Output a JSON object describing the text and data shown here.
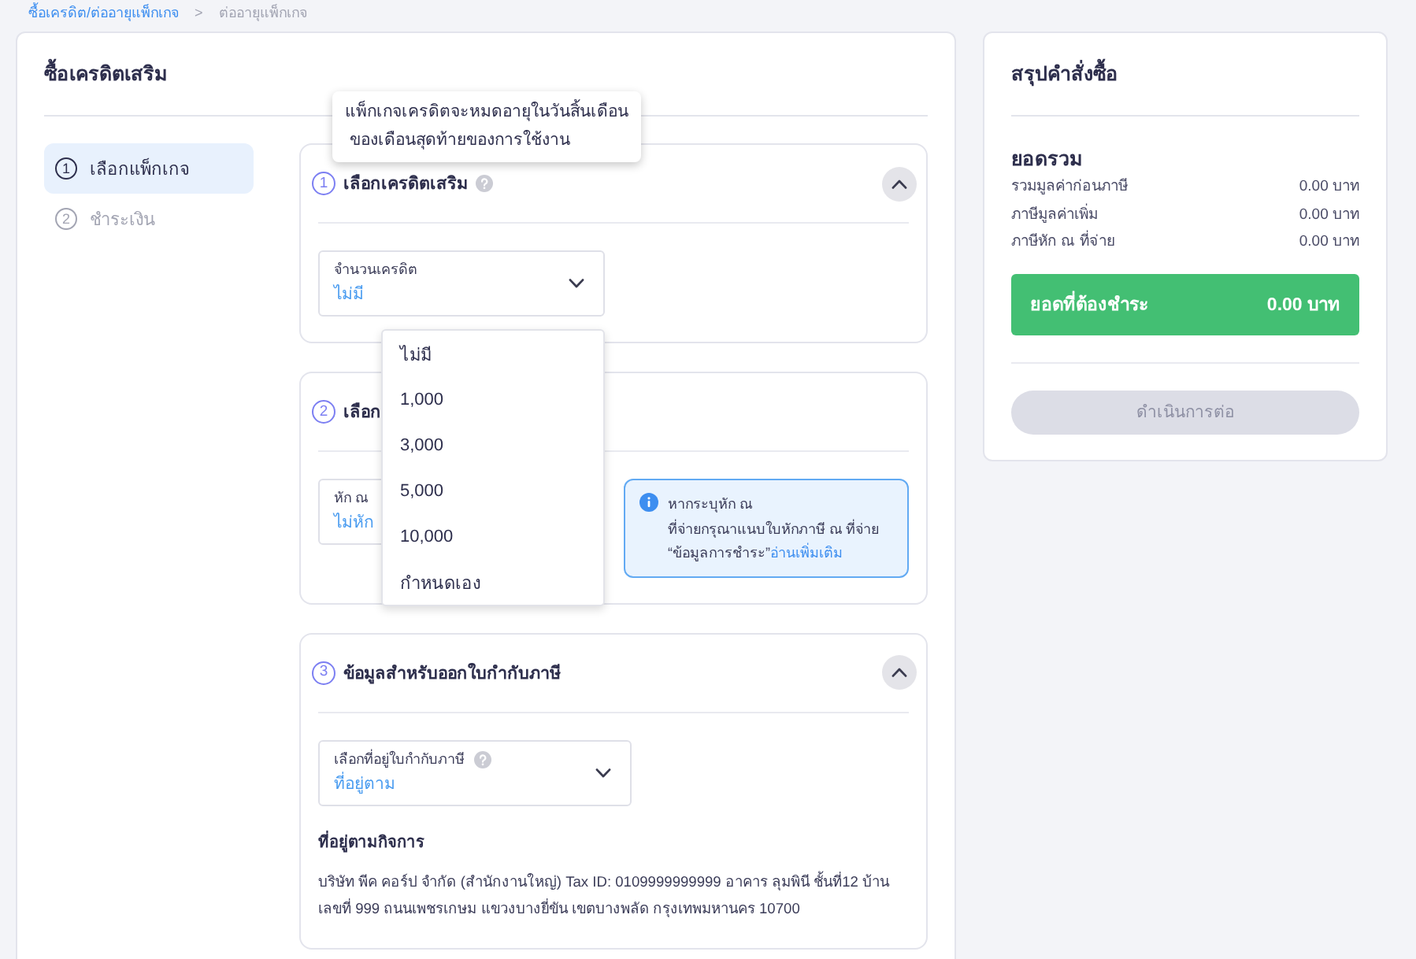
{
  "breadcrumb": {
    "separator": ">",
    "items": [
      {
        "label": "ซื้อเครดิต/ต่ออายุแพ็กเกจ",
        "kind": "link"
      },
      {
        "label": "ต่ออายุแพ็กเกจ",
        "kind": "current"
      }
    ]
  },
  "page_title": "ซื้อเครดิตเสริม",
  "steps": [
    {
      "number": "1",
      "label": "เลือกแพ็กเกจ",
      "selected": true
    },
    {
      "number": "2",
      "label": "ชำระเงิน",
      "selected": false
    }
  ],
  "sections": [
    {
      "number": "1",
      "title": "เลือกเครดิตเสริม",
      "help": true,
      "expanded": true,
      "tooltip": "แพ็กเกจเครดิตจะหมดอายุในวันสิ้นเดือน\n ของเดือนสุดท้ายของการใช้งาน",
      "field": {
        "label": "จำนวนเครดิต",
        "value": "ไม่มี",
        "chevron": true,
        "open": true,
        "options": [
          "ไม่มี",
          "1,000",
          "3,000",
          "5,000",
          "10,000",
          "กำหนดเอง"
        ]
      }
    },
    {
      "number": "2",
      "title": "เลือก",
      "field": {
        "label": "หัก ณ",
        "value": "ไม่หัก"
      },
      "info": {
        "text": "หากระบุหัก ณ\nที่จ่ายกรุณาแนบใบหักภาษี ณ ที่จ่าย\n“ข้อมูลการชำระ”",
        "link": "อ่านเพิ่มเติม"
      }
    },
    {
      "number": "3",
      "title": "ข้อมูลสำหรับออกใบกำกับภาษี",
      "expanded": true,
      "field": {
        "label": "เลือกที่อยู่ใบกำกับภาษี",
        "help": true,
        "value": "ที่อยู่ตาม",
        "chevron": true
      },
      "address": {
        "heading": "ที่อยู่ตามกิจการ",
        "text": "บริษัท พีค คอร์ป จำกัด (สำนักงานใหญ่) Tax ID: 0109999999999 อาคาร ลุมพินี ชั้นที่12 บ้านเลขที่ 999 ถนนเพชรเกษม แขวงบางยี่ขัน เขตบางพลัด กรุงเทพมหานคร 10700"
      }
    }
  ],
  "summary": {
    "title": "สรุปคำสั่งซื้อ",
    "subtitle": "ยอดรวม",
    "rows": [
      {
        "label": "รวมมูลค่าก่อนภาษี",
        "value": "0.00 บาท"
      },
      {
        "label": "ภาษีมูลค่าเพิ่ม",
        "value": "0.00 บาท"
      },
      {
        "label": "ภาษีหัก ณ ที่จ่าย",
        "value": "0.00 บาท"
      }
    ],
    "total": {
      "label": "ยอดที่ต้องชำระ",
      "value": "0.00 บาท"
    },
    "button": {
      "label": "ดำเนินการต่อ",
      "disabled": true
    }
  }
}
